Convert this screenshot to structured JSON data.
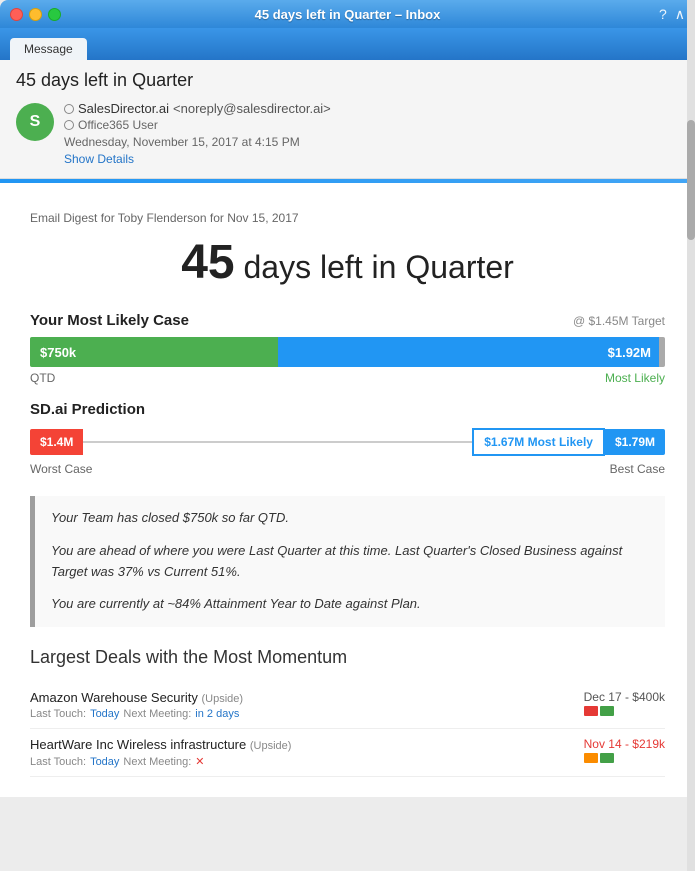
{
  "titleBar": {
    "title": "45 days left in Quarter – Inbox",
    "controls": [
      "close",
      "minimize",
      "maximize"
    ],
    "right_buttons": [
      "help",
      "collapse"
    ]
  },
  "nav": {
    "active_tab": "Message"
  },
  "email": {
    "subject": "45 days left in Quarter",
    "sender": {
      "avatar_letter": "S",
      "name": "SalesDirector.ai",
      "email": "<noreply@salesdirector.ai>",
      "org": "Office365 User",
      "date": "Wednesday, November 15, 2017 at 4:15 PM",
      "show_details": "Show Details"
    }
  },
  "content": {
    "digest_label": "Email Digest for Toby Flenderson for Nov 15, 2017",
    "headline_number": "45",
    "headline_text": "days left in Quarter",
    "most_likely": {
      "title": "Your Most Likely Case",
      "target": "@ $1.45M Target",
      "qtd_value": "$750k",
      "bar_value": "$1.92M",
      "qtd_label": "QTD",
      "most_likely_label": "Most Likely"
    },
    "prediction": {
      "title": "SD.ai Prediction",
      "worst": "$1.4M",
      "most_likely": "$1.67M Most Likely",
      "best": "$1.79M",
      "worst_label": "Worst Case",
      "best_label": "Best Case"
    },
    "paragraphs": [
      "Your Team has closed $750k so far QTD.",
      "You are ahead of where you were Last Quarter at this time. Last Quarter's Closed Business against Target was 37% vs Current 51%.",
      "You are currently at ~84% Attainment Year to Date against Plan."
    ],
    "deals_title": "Largest Deals with the Most Momentum",
    "deals": [
      {
        "name": "Amazon Warehouse Security",
        "upside": "(Upside)",
        "last_touch": "Today",
        "next_meeting": "in 2 days",
        "date": "Dec 17 - $400k",
        "date_color": "normal",
        "flags": [
          "red",
          "green"
        ]
      },
      {
        "name": "HeartWare Inc Wireless Infrastructure",
        "upside": "(Upside)",
        "last_touch": "Today",
        "next_meeting": "×",
        "date": "Nov 14 - $219k",
        "date_color": "red",
        "flags": [
          "orange",
          "green"
        ]
      }
    ]
  }
}
